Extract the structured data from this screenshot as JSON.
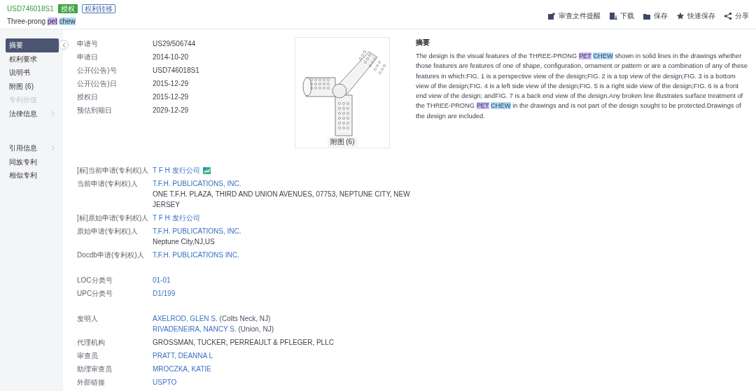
{
  "header": {
    "patent_number": "USD746018S1",
    "badges": [
      {
        "text": "授权",
        "kind": "solid"
      },
      {
        "text": "权利转移",
        "kind": "outline"
      }
    ],
    "title": [
      {
        "text": "Three-prong"
      },
      {
        "text": "pet",
        "color": "#c7b5f5"
      },
      {
        "text": "chew",
        "color": "#a9d8f7"
      }
    ]
  },
  "toolbar": [
    {
      "label": "审查文件提醒",
      "kind": "bell"
    },
    {
      "label": "下载",
      "kind": "download"
    },
    {
      "label": "保存",
      "kind": "folder"
    },
    {
      "label": "快速保存",
      "kind": "star"
    },
    {
      "label": "分享",
      "kind": "share"
    }
  ],
  "sidebar": {
    "groups": [
      [
        {
          "label": "摘要",
          "selected": true,
          "disabled": false,
          "expandable": false
        },
        {
          "label": "权利要求",
          "selected": false,
          "disabled": false,
          "expandable": false
        },
        {
          "label": "说明书",
          "selected": false,
          "disabled": false,
          "expandable": false
        },
        {
          "label": "附图 (6)",
          "selected": false,
          "disabled": false,
          "expandable": false
        },
        {
          "label": "专利价值",
          "selected": false,
          "disabled": true,
          "expandable": false
        },
        {
          "label": "法律信息",
          "selected": false,
          "disabled": false,
          "expandable": true
        }
      ],
      [
        {
          "label": "引用信息",
          "selected": false,
          "disabled": false,
          "expandable": true
        },
        {
          "label": "同族专利",
          "selected": false,
          "disabled": false,
          "expandable": false
        },
        {
          "label": "相似专利",
          "selected": false,
          "disabled": false,
          "expandable": false
        }
      ]
    ]
  },
  "basic_fields": [
    {
      "label": "申请号",
      "values": [
        {
          "text": "US29/506744",
          "link": false
        }
      ]
    },
    {
      "label": "申请日",
      "values": [
        {
          "text": "2014-10-20",
          "link": false
        }
      ]
    },
    {
      "label": "公开(公告)号",
      "values": [
        {
          "text": "USD746018S1",
          "link": false
        }
      ]
    },
    {
      "label": "公开(公告)日",
      "values": [
        {
          "text": "2015-12-29",
          "link": false
        }
      ]
    },
    {
      "label": "授权日",
      "values": [
        {
          "text": "2015-12-29",
          "link": false
        }
      ]
    },
    {
      "label": "预估到期日",
      "values": [
        {
          "text": "2029-12-29",
          "link": false
        }
      ]
    }
  ],
  "figure": {
    "caption": "附图 (6)"
  },
  "abstract": {
    "heading": "摘要",
    "text": [
      {
        "text": "The design is the visual features of the THREE-PRONG"
      },
      {
        "text": "PET",
        "color": "#c7b5f5"
      },
      {
        "text": "CHEW",
        "color": "#a9d8f7"
      },
      {
        "text": "shown in solid lines in the drawings whether those features are features of one of shape, configuration, ornament or pattern or are a combination of any of these features in which:FIG. 1 is a perspective view of the design;FIG. 2 is a top view of the design;FIG. 3 is a bottom view of the design;FIG. 4 is a left side view of the design;FIG. 5 is a right side view of the design;FIG. 6 is a front end view of the design; andFIG. 7 is a back end view of the design.Any broken line illustrates surface treatment of the THREE-PRONG"
      },
      {
        "text": "PET",
        "color": "#c7b5f5"
      },
      {
        "text": "CHEW",
        "color": "#a9d8f7"
      },
      {
        "text": "in the drawings and is not part of the design sought to be protected.Drawings of the design are included."
      }
    ]
  },
  "sections": [
    [
      {
        "label": "[标]当前申请(专利权)人",
        "values": [
          {
            "text": "T F H 发行公司",
            "link": true
          }
        ],
        "flag": true
      },
      {
        "label": "当前申请(专利权)人",
        "values": [
          {
            "text": "T.F.H. PUBLICATIONS, INC.",
            "link": true
          },
          {
            "text": "ONE T.F.H. PLAZA, THIRD AND UNION AVENUES, 07753, NEPTUNE CITY, NEW JERSEY",
            "link": false
          }
        ],
        "flag": false
      },
      {
        "label": "[标]原始申请(专利权)人",
        "values": [
          {
            "text": "T F H 发行公司",
            "link": true
          }
        ],
        "flag": false
      },
      {
        "label": "原始申请(专利权)人",
        "values": [
          {
            "text": "T.F.H. PUBLICATIONS, INC.",
            "link": true
          },
          {
            "text": "Neptune City,NJ,US",
            "link": false
          }
        ],
        "flag": false
      },
      {
        "label": "Docdb申请(专利权)人",
        "values": [
          {
            "text": "T.F.H. PUBLICATIONS INC.",
            "link": true
          }
        ],
        "flag": false
      }
    ],
    [
      {
        "label": "LOC分类号",
        "values": [
          {
            "text": "01-01",
            "link": true
          }
        ],
        "flag": false
      },
      {
        "label": "UPC分类号",
        "values": [
          {
            "text": "D1/199",
            "link": true
          }
        ],
        "flag": false
      }
    ],
    [
      {
        "label": "发明人",
        "values": [
          {
            "text": "AXELROD, GLEN S.",
            "link": true,
            "note": " (Colts Neck, NJ)"
          },
          {
            "text": "RIVADENEIRA, NANCY S.",
            "link": true,
            "note": " (Union, NJ)"
          }
        ],
        "flag": false
      },
      {
        "label": "代理机构",
        "values": [
          {
            "text": "GROSSMAN, TUCKER, PERREAULT & PFLEGER, PLLC",
            "link": false
          }
        ],
        "flag": false
      },
      {
        "label": "审查员",
        "values": [
          {
            "text": "PRATT, DEANNA L",
            "link": true
          }
        ],
        "flag": false
      },
      {
        "label": "助理审查员",
        "values": [
          {
            "text": "MROCZKA, KATIE",
            "link": true
          }
        ],
        "flag": false
      },
      {
        "label": "外部链接",
        "values": [
          {
            "text": "USPTO",
            "link": true
          }
        ],
        "flag": false
      }
    ]
  ]
}
